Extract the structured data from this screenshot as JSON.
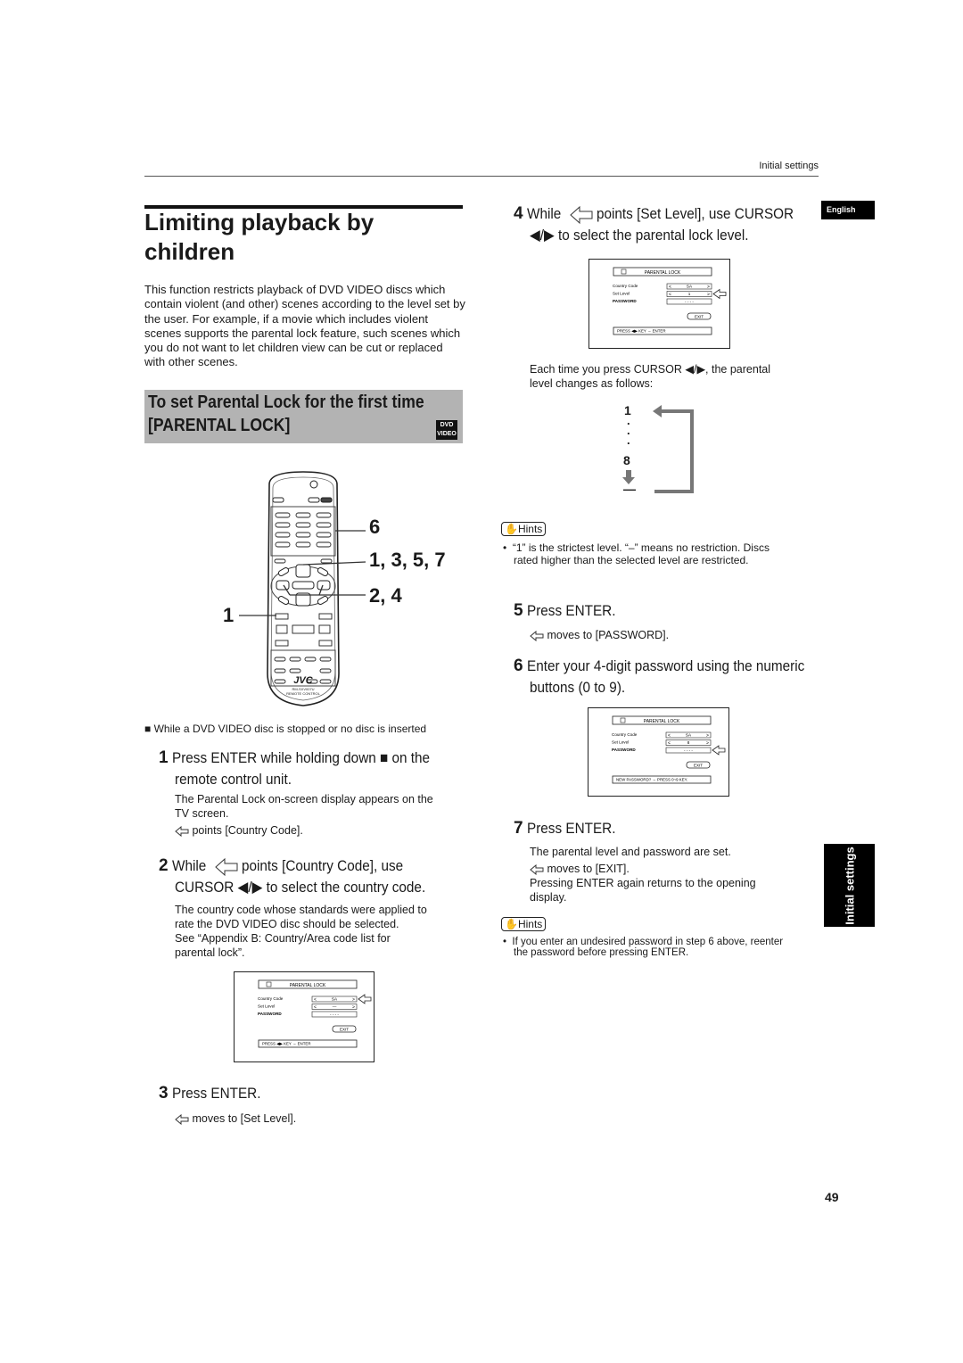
{
  "header": {
    "section": "Initial settings",
    "language_tab": "English",
    "side_tab": "Initial settings"
  },
  "title": {
    "line1": "Limiting playback by",
    "line2": "children"
  },
  "intro": "This function restricts playback of DVD VIDEO discs which contain violent (and other) scenes according to the level set by the user. For example, if a movie which includes violent scenes supports the parental lock feature, such scenes which you do not want to let children view can be cut or replaced with other scenes.",
  "subheading": {
    "line1": "To set Parental Lock for the first time",
    "line2": "[PARENTAL LOCK]",
    "badge_top": "DVD",
    "badge_bottom": "VIDEO"
  },
  "remote": {
    "brand": "JVC",
    "model": "RM-SXV007U",
    "caption": "REMOTE CONTROL",
    "callouts": [
      "6",
      "1, 3, 5, 7",
      "2, 4",
      "1"
    ]
  },
  "condition_note": "While a DVD VIDEO disc is stopped or no disc is inserted",
  "steps": [
    {
      "num": "1",
      "title_a": "Press ENTER while holding down ■ on the",
      "title_b": "remote control unit.",
      "body": [
        "The Parental Lock on-screen display appears on the",
        "TV screen."
      ],
      "pointer_text": "points [Country Code]."
    },
    {
      "num": "2",
      "title_a_pre": "While",
      "title_a_post": "points [Country Code], use",
      "title_b": "CURSOR ◀/▶ to select the country code.",
      "body": [
        "The country code whose standards were applied to",
        "rate the DVD VIDEO disc should be selected.",
        "See “Appendix B: Country/Area code list for",
        "parental lock”."
      ]
    },
    {
      "num": "3",
      "title": "Press ENTER.",
      "pointer_text": "moves to [Set Level]."
    },
    {
      "num": "4",
      "title_a_pre": "While",
      "title_a_post": "points [Set Level], use CURSOR",
      "title_b": "◀/▶ to select the parental lock level.",
      "body": [
        "Each time you press  CURSOR ◀/▶, the parental",
        "level changes as follows:"
      ]
    },
    {
      "num": "5",
      "title": "Press ENTER.",
      "pointer_text": "moves to [PASSWORD]."
    },
    {
      "num": "6",
      "title_a": "Enter your 4-digit password using the numeric",
      "title_b": "buttons (0 to 9)."
    },
    {
      "num": "7",
      "title": "Press ENTER.",
      "body1": "The parental level and password are set.",
      "pointer_text": "moves to [EXIT].",
      "body2": [
        "Pressing ENTER again returns to the opening",
        "display."
      ]
    }
  ],
  "osd_screens": [
    {
      "title": "PARENTAL LOCK",
      "rows": [
        {
          "label": "Country Code",
          "value": "SA"
        },
        {
          "label": "Set Level",
          "value": "—"
        },
        {
          "label": "PASSWORD",
          "value": "- - - -"
        }
      ],
      "pointer_row": 0,
      "exit": "EXIT",
      "status": "PRESS ◀▶ KEY → ENTER"
    },
    {
      "title": "PARENTAL LOCK",
      "rows": [
        {
          "label": "Country Code",
          "value": "SA"
        },
        {
          "label": "Set Level",
          "value": "1"
        },
        {
          "label": "PASSWORD",
          "value": "- - - -"
        }
      ],
      "pointer_row": 1,
      "exit": "EXIT",
      "status": "PRESS ◀▶ KEY → ENTER"
    },
    {
      "title": "PARENTAL LOCK",
      "rows": [
        {
          "label": "Country Code",
          "value": "SA"
        },
        {
          "label": "Set Level",
          "value": "8"
        },
        {
          "label": "PASSWORD",
          "value": "- - - -"
        }
      ],
      "pointer_row": 2,
      "exit": "EXIT",
      "status": "NEW PASSWORD? → PRESS 0~9 KEY."
    }
  ],
  "level_cycle": {
    "first": "1",
    "dots": ".",
    "last": "8",
    "none": "—"
  },
  "hints": [
    {
      "label": "Hints",
      "text": [
        "“1” is the strictest level. “–” means no restriction. Discs",
        "rated higher than the selected level are restricted."
      ]
    },
    {
      "label": "Hints",
      "text": [
        "If you enter an undesired password in step 6 above, reenter",
        "the password before pressing ENTER."
      ]
    }
  ],
  "page_number": "49"
}
